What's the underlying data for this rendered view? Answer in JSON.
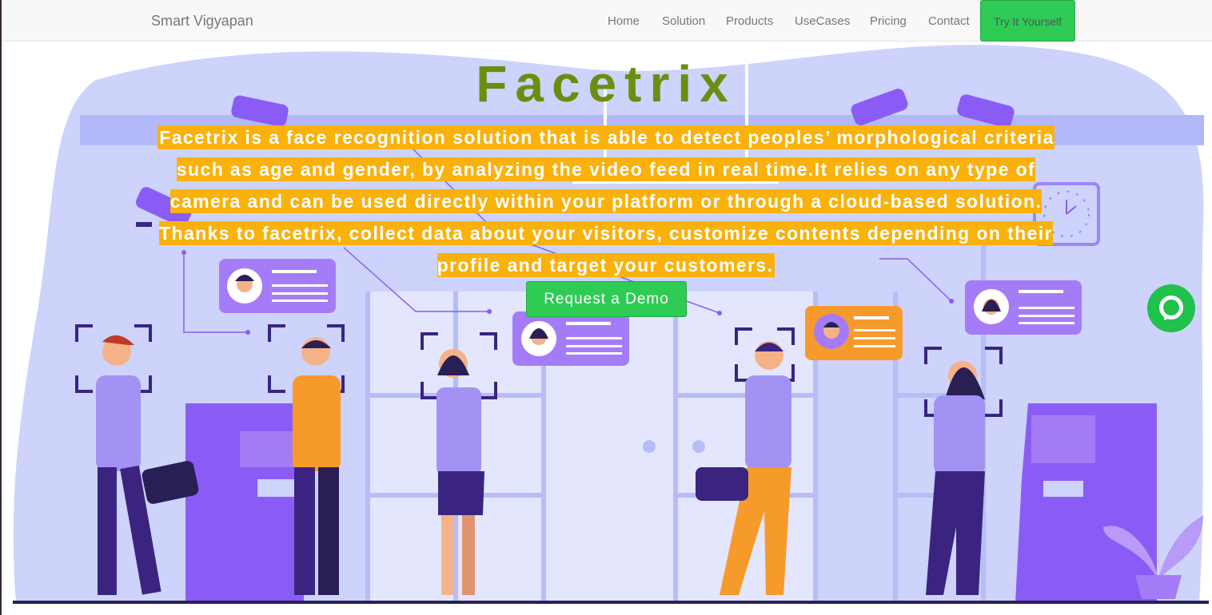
{
  "navbar": {
    "brand": "Smart Vigyapan",
    "items": [
      {
        "label": "Home"
      },
      {
        "label": "Solution"
      },
      {
        "label": "Products"
      },
      {
        "label": "UseCases"
      },
      {
        "label": "Pricing"
      },
      {
        "label": "Contact"
      }
    ],
    "cta_label": "Try It Yourself"
  },
  "hero": {
    "title": "Facetrix",
    "description": "Facetrix is a face recognition solution that is able to detect peoples’ morphological criteria such as age and gender, by analyzing the video feed in real time.It relies on any type of camera and can be used directly within your platform or through a cloud-based solution. Thanks to facetrix, collect data about your visitors, customize contents depending on their profile and target your customers.",
    "demo_label": "Request a Demo"
  },
  "colors": {
    "accent_green": "#2ecc55",
    "title_green": "#6b8e12",
    "highlight_orange": "#f9b10b",
    "illustration_bg": "#cdd3fb",
    "purple": "#8a5cf5"
  },
  "icons": [
    "chat-icon",
    "security-camera-icon",
    "clock-icon",
    "profile-card-icon"
  ]
}
